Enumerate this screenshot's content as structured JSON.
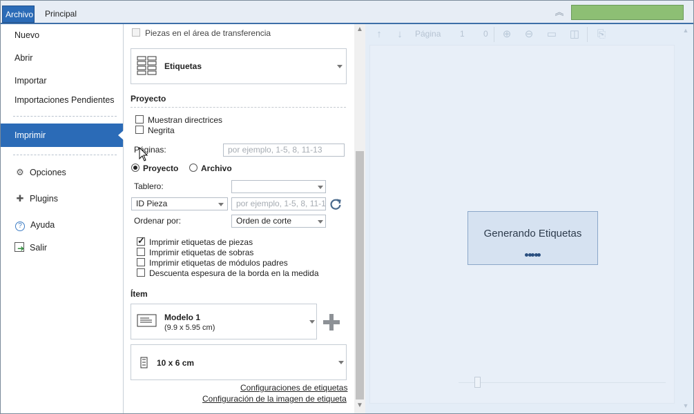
{
  "tabs": {
    "archivo": "Archivo",
    "principal": "Principal"
  },
  "nav": {
    "nuevo": "Nuevo",
    "abrir": "Abrir",
    "importar": "Importar",
    "importaciones": "Importaciones Pendientes",
    "imprimir": "Imprimir",
    "opciones": "Opciones",
    "plugins": "Plugins",
    "ayuda": "Ayuda",
    "salir": "Salir"
  },
  "panel": {
    "transfer_label": "Piezas en el área de transferencia",
    "report_type": "Etiquetas",
    "proyecto_section": "Proyecto",
    "show_guidelines": "Muestran directrices",
    "bold_label": "Negrita",
    "pages_label": "Páginas:",
    "pages_placeholder": "por ejemplo, 1-5, 8, 11-13",
    "radio_proyecto": "Proyecto",
    "radio_archivo": "Archivo",
    "board_label": "Tablero:",
    "board_value": "",
    "id_select": "ID Pieza",
    "id_placeholder": "por ejemplo, 1-5, 8, 11-13",
    "sort_label": "Ordenar por:",
    "sort_value": "Orden de corte",
    "opt_piezas": "Imprimir etiquetas de piezas",
    "opt_piezas_checked": true,
    "opt_sobras": "Imprimir etiquetas de sobras",
    "opt_modulos": "Imprimir etiquetas de módulos padres",
    "opt_borda": "Descuenta espesura de la borda en la medida",
    "item_section": "Ítem",
    "model_name": "Modelo 1",
    "model_size": "(9.9 x 5.95 cm)",
    "label_size": "10 x 6 cm",
    "link_config": "Configuraciones de etiquetas",
    "link_image": "Configuración de la imagen de etiqueta"
  },
  "preview": {
    "page_label": "Página",
    "page_current": "1",
    "page_total": "0",
    "generating": "Generando Etiquetas"
  },
  "colors": {
    "accent": "#2b6bb7",
    "progress_green": "#8dbf74",
    "preview_bg": "#e4edf7"
  }
}
